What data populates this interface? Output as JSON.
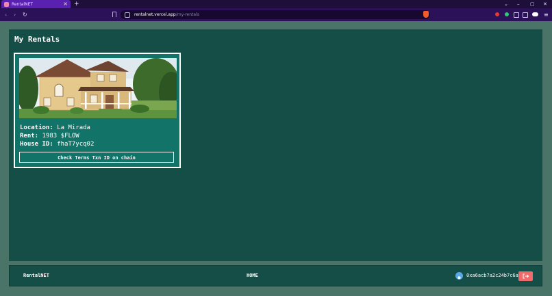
{
  "browser": {
    "tab_title": "RentalNET",
    "tab_close": "×",
    "new_tab": "+",
    "url_host": "rentalnet.vercel.app",
    "url_path": "/my-rentals",
    "window_controls": [
      "⌄",
      "–",
      "▢",
      "✕"
    ],
    "nav": [
      "‹",
      "›",
      "↻"
    ],
    "menu": "≡",
    "icons": {
      "favicon": "rentalnet-favicon-icon",
      "bookmark": "bookmark-icon",
      "secure": "site-info-icon",
      "brave": "brave-shield-icon"
    },
    "colors": {
      "tabbar": "#1d0f3a",
      "active_tab": "#5a21b0",
      "toolbar": "#2a1158"
    }
  },
  "page": {
    "title": "My Rentals",
    "colors": {
      "background": "#4b7468",
      "panel": "#154d47",
      "card": "#127368",
      "logout": "#ef6b6b"
    }
  },
  "rentals": [
    {
      "location_label": "Location:",
      "location": "La Mirada",
      "rent_label": "Rent:",
      "rent": "1983 $FLOW",
      "house_id_label": "House ID:",
      "house_id": "fhaT7ycq02",
      "button_label": "Check Terms Txn ID on chain"
    }
  ],
  "footer": {
    "brand": "RentalNET",
    "home": "HOME",
    "wallet": "0xa6acb7a2c24b7c6a",
    "avatar_icon": "user-avatar-icon",
    "logout_icon": "logout-icon"
  }
}
